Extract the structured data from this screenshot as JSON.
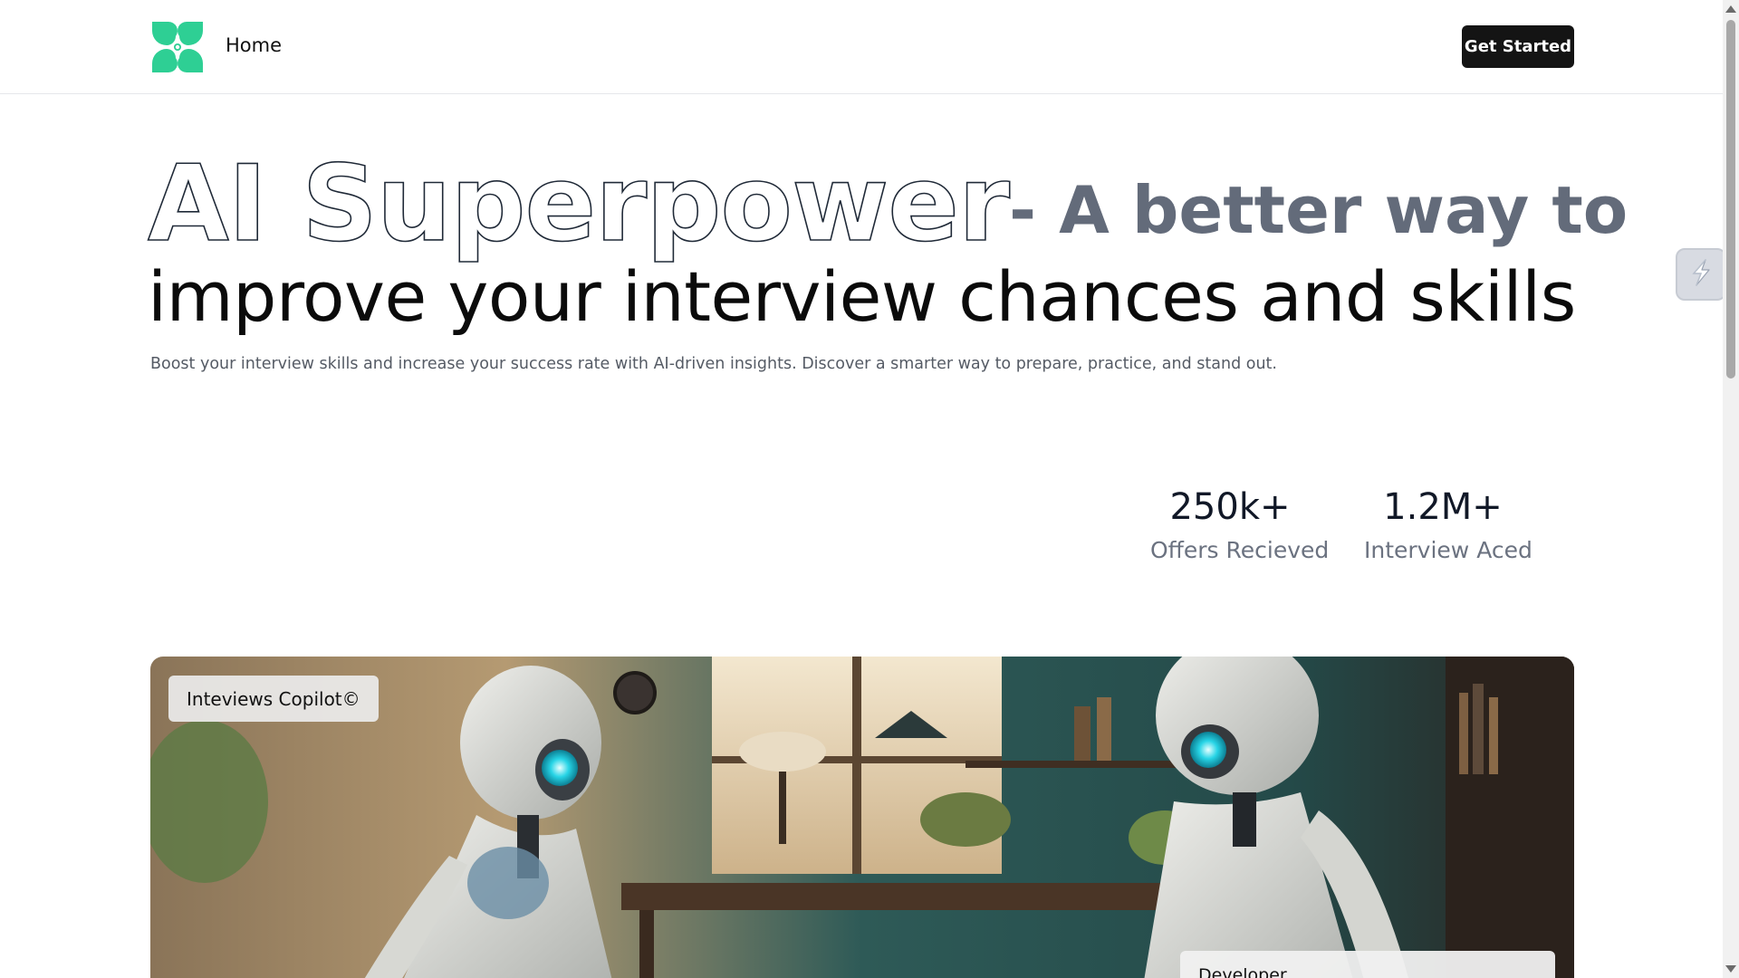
{
  "header": {
    "logo_icon": "four-leaf-clover-logo",
    "nav_home": "Home",
    "cta_label": "Get Started"
  },
  "hero": {
    "title_outline": "AI Superpower",
    "title_bold": "- A better way to",
    "title_line2": "improve your interview chances and skills",
    "subtitle": "Boost your interview skills and increase your success rate with AI-driven insights. Discover a smarter way to prepare, practice, and stand out."
  },
  "stats": [
    {
      "value": "250k+",
      "label": "Offers Recieved"
    },
    {
      "value": "1.2M+",
      "label": "Interview Aced"
    }
  ],
  "showcase": {
    "tag": "Inteviews Copilot©",
    "role_chip": "Developer",
    "image_icon": "two-robots-interview-illustration"
  },
  "widget": {
    "icon": "lightning-bolt-icon"
  },
  "colors": {
    "brand_green": "#2ecf94",
    "cta_bg": "#141414",
    "title_grey": "#636b7a"
  }
}
